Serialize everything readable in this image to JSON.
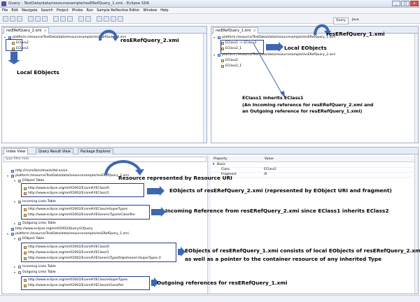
{
  "window": {
    "title": "Query - TestData/data/resourcesample/resERefQuery_1.xmi - Eclipse SDK",
    "minimize": "_",
    "maximize": "□",
    "close": "x"
  },
  "menu": [
    "File",
    "Edit",
    "Navigate",
    "Search",
    "Project",
    "IProbe",
    "Run",
    "Sample Reflective Editor",
    "Window",
    "Help"
  ],
  "left_editor": {
    "tab": "resERefQuery_2.xmi",
    "tab_close": "x",
    "path": "platform:/resource/TestData/data/resourcesample/resERefQuery_2.xmi",
    "items": [
      "EClass2",
      "EClass1"
    ]
  },
  "right_editor": {
    "tab": "resERefQuery_1.xmi",
    "tab_close": "x",
    "perspectives": [
      "Query",
      "Java"
    ],
    "path1": "platform:/resource/TestData/data/resourcesample/resERefQuery_1.xmi",
    "items1": [
      "EClass1 -> EClass2",
      "EClass2_1"
    ],
    "path2": "platform:/resource/TestData/data/resourcesample/resERefQuery_2.xmi",
    "items2": [
      "EClass2",
      "EClass2_1"
    ]
  },
  "bottom": {
    "tabs": [
      "Index View",
      "Query Result View",
      "Package Explorer"
    ],
    "filter_placeholder": "type filter text",
    "tree": [
      "http:///com/ibm/etools/dtd.ecore",
      "platform:/resource/TestData/data/resourcesample/resERefQuery_2.xmi",
      "EObject Table",
      "http://www.eclipse.org/emf/2002/Ecore#//EClass/0",
      "http://www.eclipse.org/emf/2002/Ecore#//EClass/1",
      "Incoming Links Table",
      "http://www.eclipse.org/emf/2002/Ecore#//EClass/eSuperTypes",
      "http://www.eclipse.org/emf/2002/Ecore#//EGenericType/eClassifier",
      "Outgoing Links Table",
      "http://www.eclipse.org/emf/2002/Query/2/Query",
      "platform:/resource/TestData/data/resourcesample/resERefQuery_1.xmi",
      "EObject Table",
      "http://www.eclipse.org/emf/2002/Ecore#//EClass/0",
      "http://www.eclipse.org/emf/2002/Ecore#//EClass/1",
      "http://www.eclipse.org/emf/2002/Ecore#//EGenericType/0/@eGenericSuperTypes.0",
      "Incoming Links Table",
      "Outgoing Links Table",
      "http://www.eclipse.org/emf/2002/Ecore#//EClass/eSuperTypes",
      "http://www.eclipse.org/emf/2002/Ecore#//EClass/eClassifier"
    ],
    "properties": {
      "header_property": "Property",
      "header_value": "Value",
      "group": "Basic",
      "rows": [
        {
          "property": "Class",
          "value": "EClass2"
        },
        {
          "property": "Fragment",
          "value": "/0"
        }
      ]
    }
  },
  "annotations": {
    "res2_label": "resERefQuery_2.xmi",
    "res1_label": "resERefQuery_1.xmi",
    "local_eobjects_left": "Local EObjects",
    "local_eobjects_right": "Local EObjects",
    "inherits_l1": "EClass1 inherits EClass1",
    "inherits_l2": "(An Incoming reference for resERefQuery_2.xmi and",
    "inherits_l3": "an Outgoing reference for resERefQuery_1.xmi)",
    "resource_uri": "Resource represented by Resource URI",
    "eobjects_res2": "EObjects of resERefQuery_2.xmi (represented by EObject  URI and fragment)",
    "incoming_ref": "Incoming Reference from resERefQuery_2.xmi since EClass1 inherits EClass2",
    "eobjects_res1_l1": "EObjects of resERefQuery_1.xmi consists of local EObjects of resERefQuery_2.xmi",
    "eobjects_res1_l2": "as well as a pointer to the container resource of any inherited Type",
    "outgoing_ref": "Outgoing references for resERefQuery_1.xmi"
  },
  "colors": {
    "arrow": "#3f66b1",
    "box": "#233f8a",
    "panel_border": "#9fb0c8"
  }
}
